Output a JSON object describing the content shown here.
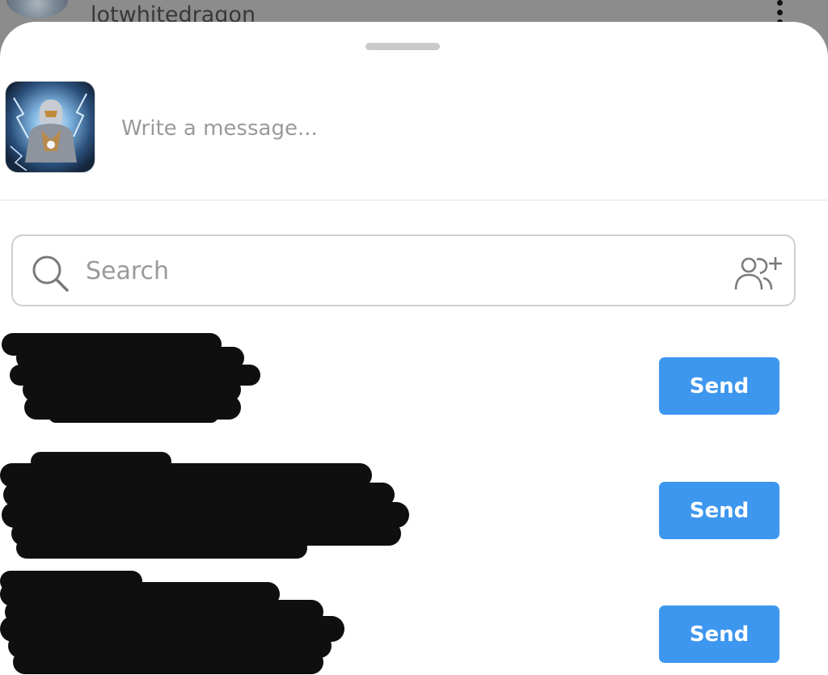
{
  "backdrop": {
    "username": "lotwhitedragon",
    "more_icon": "more-vertical-icon"
  },
  "share_sheet": {
    "composer": {
      "thumbnail_icon": "post-thumbnail",
      "message_placeholder": "Write a message..."
    },
    "search": {
      "icon": "search-icon",
      "placeholder": "Search",
      "add_icon": "add-people-icon"
    },
    "recipients": [
      {
        "name": "",
        "send_label": "Send"
      },
      {
        "name": "",
        "send_label": "Send"
      },
      {
        "name": "",
        "send_label": "Send"
      }
    ]
  },
  "colors": {
    "accent": "#3d97ee",
    "sheet_background": "#ffffff",
    "backdrop": "#8c8c8c",
    "redaction": "#0f0f0f"
  }
}
